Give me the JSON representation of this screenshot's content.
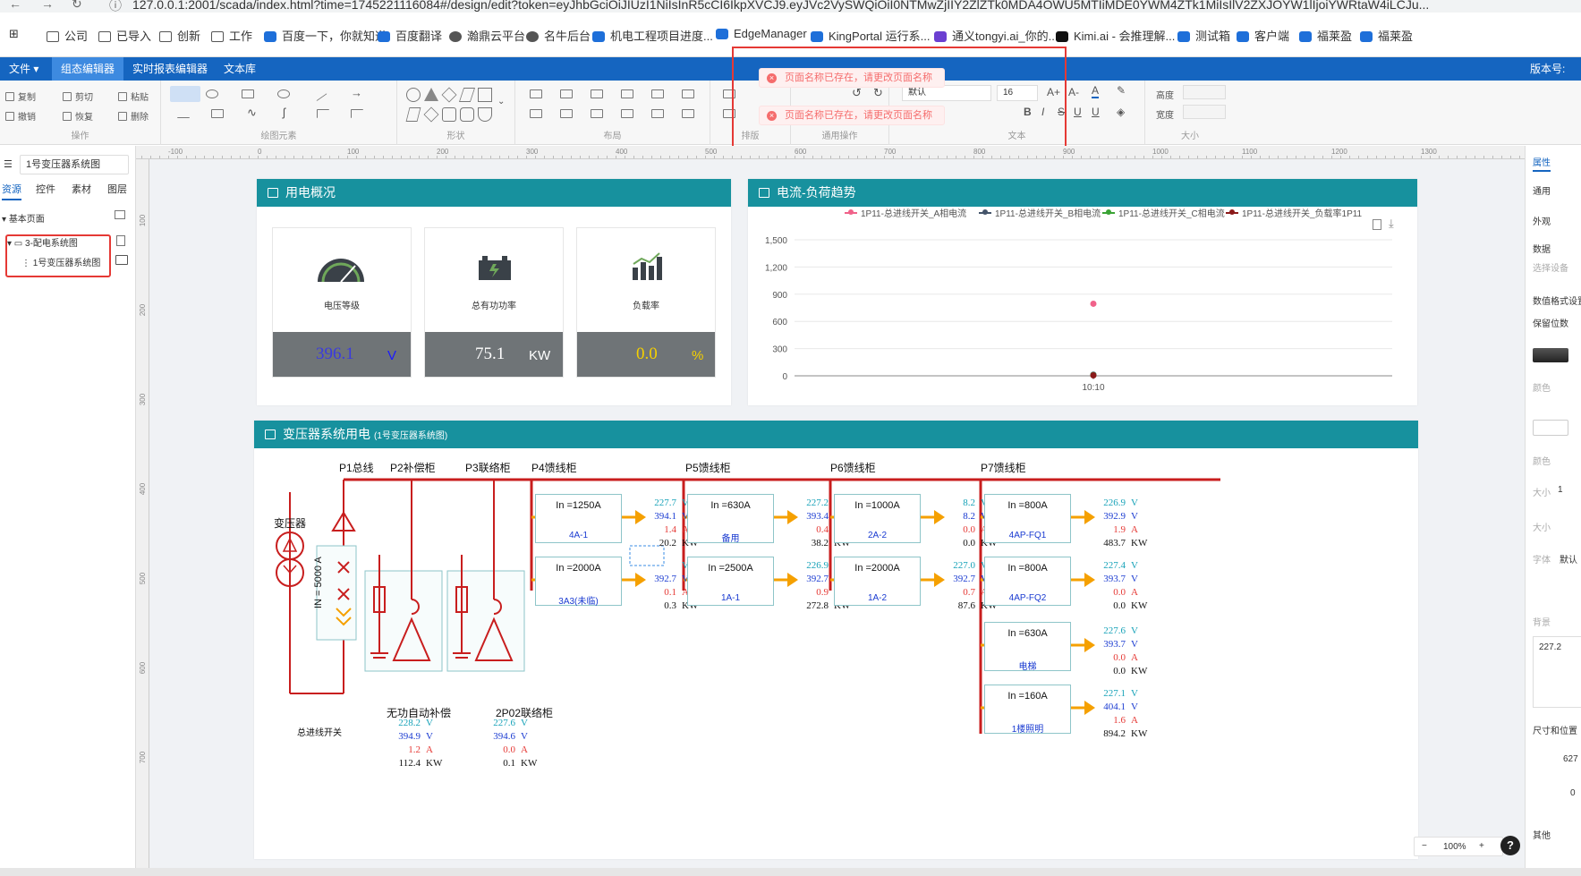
{
  "browser": {
    "url": "127.0.0.1:2001/scada/index.html?time=1745221116084#/design/edit?token=eyJhbGciOiJIUzI1NiIsInR5cCI6IkpXVCJ9.eyJVc2VySWQiOiI0NTMwZjIIY2ZlZTk0MDA4OWU5MTIiMDE0YWM4ZTk1MiIsIlV2ZXJOYW1lIjoiYWRtaW4iLCJu...",
    "bookmarks": [
      {
        "label": "公司",
        "icon": "folder-icon"
      },
      {
        "label": "已导入",
        "icon": "folder-icon"
      },
      {
        "label": "创新",
        "icon": "folder-icon"
      },
      {
        "label": "工作",
        "icon": "folder-icon"
      },
      {
        "label": "百度一下，你就知道",
        "icon": "baidu-icon"
      },
      {
        "label": "百度翻译",
        "icon": "translate-icon"
      },
      {
        "label": "瀚鼎云平台",
        "icon": "globe-icon"
      },
      {
        "label": "名牛后台",
        "icon": "globe-icon"
      },
      {
        "label": "机电工程项目进度...",
        "icon": "project-icon"
      },
      {
        "label": "EdgeManager",
        "icon": "edge-icon"
      },
      {
        "label": "KingPortal 运行系...",
        "icon": "user-icon"
      },
      {
        "label": "通义tongyi.ai_你的...",
        "icon": "tongyi-icon"
      },
      {
        "label": "Kimi.ai - 会推理解...",
        "icon": "kimi-icon"
      },
      {
        "label": "测试箱",
        "icon": "edge-icon"
      },
      {
        "label": "客户端",
        "icon": "edge-icon"
      },
      {
        "label": "福莱盈",
        "icon": "edge-icon"
      },
      {
        "label": "福莱盈",
        "icon": "user-icon"
      }
    ]
  },
  "menubar": {
    "file": "文件 ▾",
    "tabs": [
      "组态编辑器",
      "实时报表编辑器",
      "文本库"
    ],
    "version": "版本号:"
  },
  "toolbar": {
    "ops": {
      "copy": "复制",
      "cut": "剪切",
      "paste": "粘贴",
      "undo": "撤销",
      "redo": "恢复",
      "delete": "删除",
      "caption": "操作"
    },
    "draw_caption": "绘图元素",
    "shape_caption": "形状",
    "layout_caption": "布局",
    "arrange_caption": "排版",
    "common_caption": "通用操作",
    "text_caption": "文本",
    "font_name": "默认",
    "font_size": "16",
    "size_caption": "大小",
    "height_label": "高度",
    "width_label": "宽度"
  },
  "toasts": [
    "页面名称已存在，请更改页面名称",
    "页面名称已存在，请更改页面名称"
  ],
  "leftpanel": {
    "page_name": "1号变压器系统图",
    "tabs": [
      "资源",
      "控件",
      "素材",
      "图层"
    ],
    "tree": {
      "root": "基本页面",
      "folder": "3-配电系统图",
      "page": "1号变压器系统图"
    }
  },
  "ruler": {
    "h": [
      "-100",
      "0",
      "100",
      "200",
      "300",
      "400",
      "500",
      "600",
      "700",
      "800",
      "900",
      "1000",
      "1100",
      "1200",
      "1300"
    ],
    "v": [
      "100",
      "200",
      "300",
      "400",
      "500",
      "600",
      "700"
    ]
  },
  "overview": {
    "title": "用电概况",
    "kpis": [
      {
        "label": "电压等级",
        "value": "396.1",
        "unit": "V",
        "value_color": "#3a3adf",
        "unit_color": "#1a1aff",
        "icon": "gauge-icon"
      },
      {
        "label": "总有功功率",
        "value": "75.1",
        "unit": "KW",
        "value_color": "#ffffff",
        "unit_color": "#ffffff",
        "icon": "battery-icon"
      },
      {
        "label": "负载率",
        "value": "0.0",
        "unit": "%",
        "value_color": "#f5d000",
        "unit_color": "#f5d000",
        "icon": "bar-chart-icon"
      }
    ]
  },
  "trend": {
    "title": "电流-负荷趋势",
    "icons": [
      "document-icon",
      "download-icon"
    ]
  },
  "chart_data": {
    "type": "scatter",
    "series": [
      {
        "name": "1P11-总进线开关_A相电流",
        "color": "#f0628a",
        "points": [
          {
            "x": "10:10",
            "y": 795
          }
        ]
      },
      {
        "name": "1P11-总进线开关_B相电流",
        "color": "#44546a",
        "points": [
          {
            "x": "10:10",
            "y": 12
          }
        ]
      },
      {
        "name": "1P11-总进线开关_C相电流",
        "color": "#3aa335",
        "points": [
          {
            "x": "10:10",
            "y": 8
          }
        ]
      },
      {
        "name": "1P11-总进线开关_负载率1P11",
        "color": "#8b1a1a",
        "points": [
          {
            "x": "10:10",
            "y": 5
          }
        ]
      }
    ],
    "x": [
      "10:10"
    ],
    "yticks": [
      0,
      300,
      600,
      900,
      1200,
      1500
    ],
    "ylim": [
      0,
      1500
    ],
    "grid": true,
    "legend": "top"
  },
  "diagram": {
    "title": "变压器系统用电",
    "subtitle": "(1号变压器系统图)",
    "transformer_label": "变压器",
    "main_switch_label": "总进线开关",
    "rating_label": "IN = 5000 A",
    "comp_label": "无功自动补偿",
    "tie_label": "2P02联络柜",
    "cabinets": [
      "P1总线",
      "P2补偿柜",
      "P3联络柜",
      "P4馈线柜",
      "P5馈线柜",
      "P6馈线柜",
      "P7馈线柜"
    ],
    "p2_readings": {
      "v1": "228.2",
      "v2": "394.9",
      "a": "1.2",
      "kw": "112.4"
    },
    "p3_readings": {
      "v1": "227.6",
      "v2": "394.6",
      "a": "0.0",
      "kw": "0.1"
    },
    "feeders": [
      {
        "rating": "In =1250A",
        "name": "4A-1",
        "v1": "227.7",
        "v2": "394.1",
        "a": "1.4",
        "kw": "20.2"
      },
      {
        "rating": "In =2000A",
        "name": "3A3(未临)",
        "v1": "",
        "v2": "392.7",
        "a": "0.1",
        "kw": "0.3"
      },
      {
        "rating": "In =630A",
        "name": "备用",
        "v1": "227.2",
        "v2": "393.4",
        "a": "0.4",
        "kw": "38.2"
      },
      {
        "rating": "In =2500A",
        "name": "1A-1",
        "v1": "226.9",
        "v2": "392.7",
        "a": "0.9",
        "kw": "272.8"
      },
      {
        "rating": "In =1000A",
        "name": "2A-2",
        "v1": "8.2",
        "v2": "8.2",
        "a": "0.0",
        "kw": "0.0"
      },
      {
        "rating": "In =2000A",
        "name": "1A-2",
        "v1": "227.0",
        "v2": "392.7",
        "a": "0.7",
        "kw": "87.6"
      },
      {
        "rating": "In =800A",
        "name": "4AP-FQ1",
        "v1": "226.9",
        "v2": "392.9",
        "a": "1.9",
        "kw": "483.7"
      },
      {
        "rating": "In =800A",
        "name": "4AP-FQ2",
        "v1": "227.4",
        "v2": "393.7",
        "a": "0.0",
        "kw": "0.0"
      },
      {
        "rating": "In =630A",
        "name": "电梯",
        "v1": "227.6",
        "v2": "393.7",
        "a": "0.0",
        "kw": "0.0"
      },
      {
        "rating": "In =160A",
        "name": "1楼照明",
        "v1": "227.1",
        "v2": "404.1",
        "a": "1.6",
        "kw": "894.2"
      }
    ],
    "units": {
      "v": "V",
      "a": "A",
      "kw": "KW"
    }
  },
  "rightpanel": {
    "tab": "属性",
    "items": [
      "通用",
      "外观",
      "数据",
      "选择设备",
      "数值格式设置",
      "保留位数",
      "颜色",
      "颜色",
      "大小",
      "大小",
      "字体",
      "默认",
      "背景",
      "尺寸和位置",
      "其他"
    ],
    "text_value": "227.2",
    "size_value": "1",
    "x_value": "627",
    "angle_value": "0"
  },
  "zoom": {
    "minus": "−",
    "value": "100%",
    "plus": "+"
  },
  "help": "?"
}
